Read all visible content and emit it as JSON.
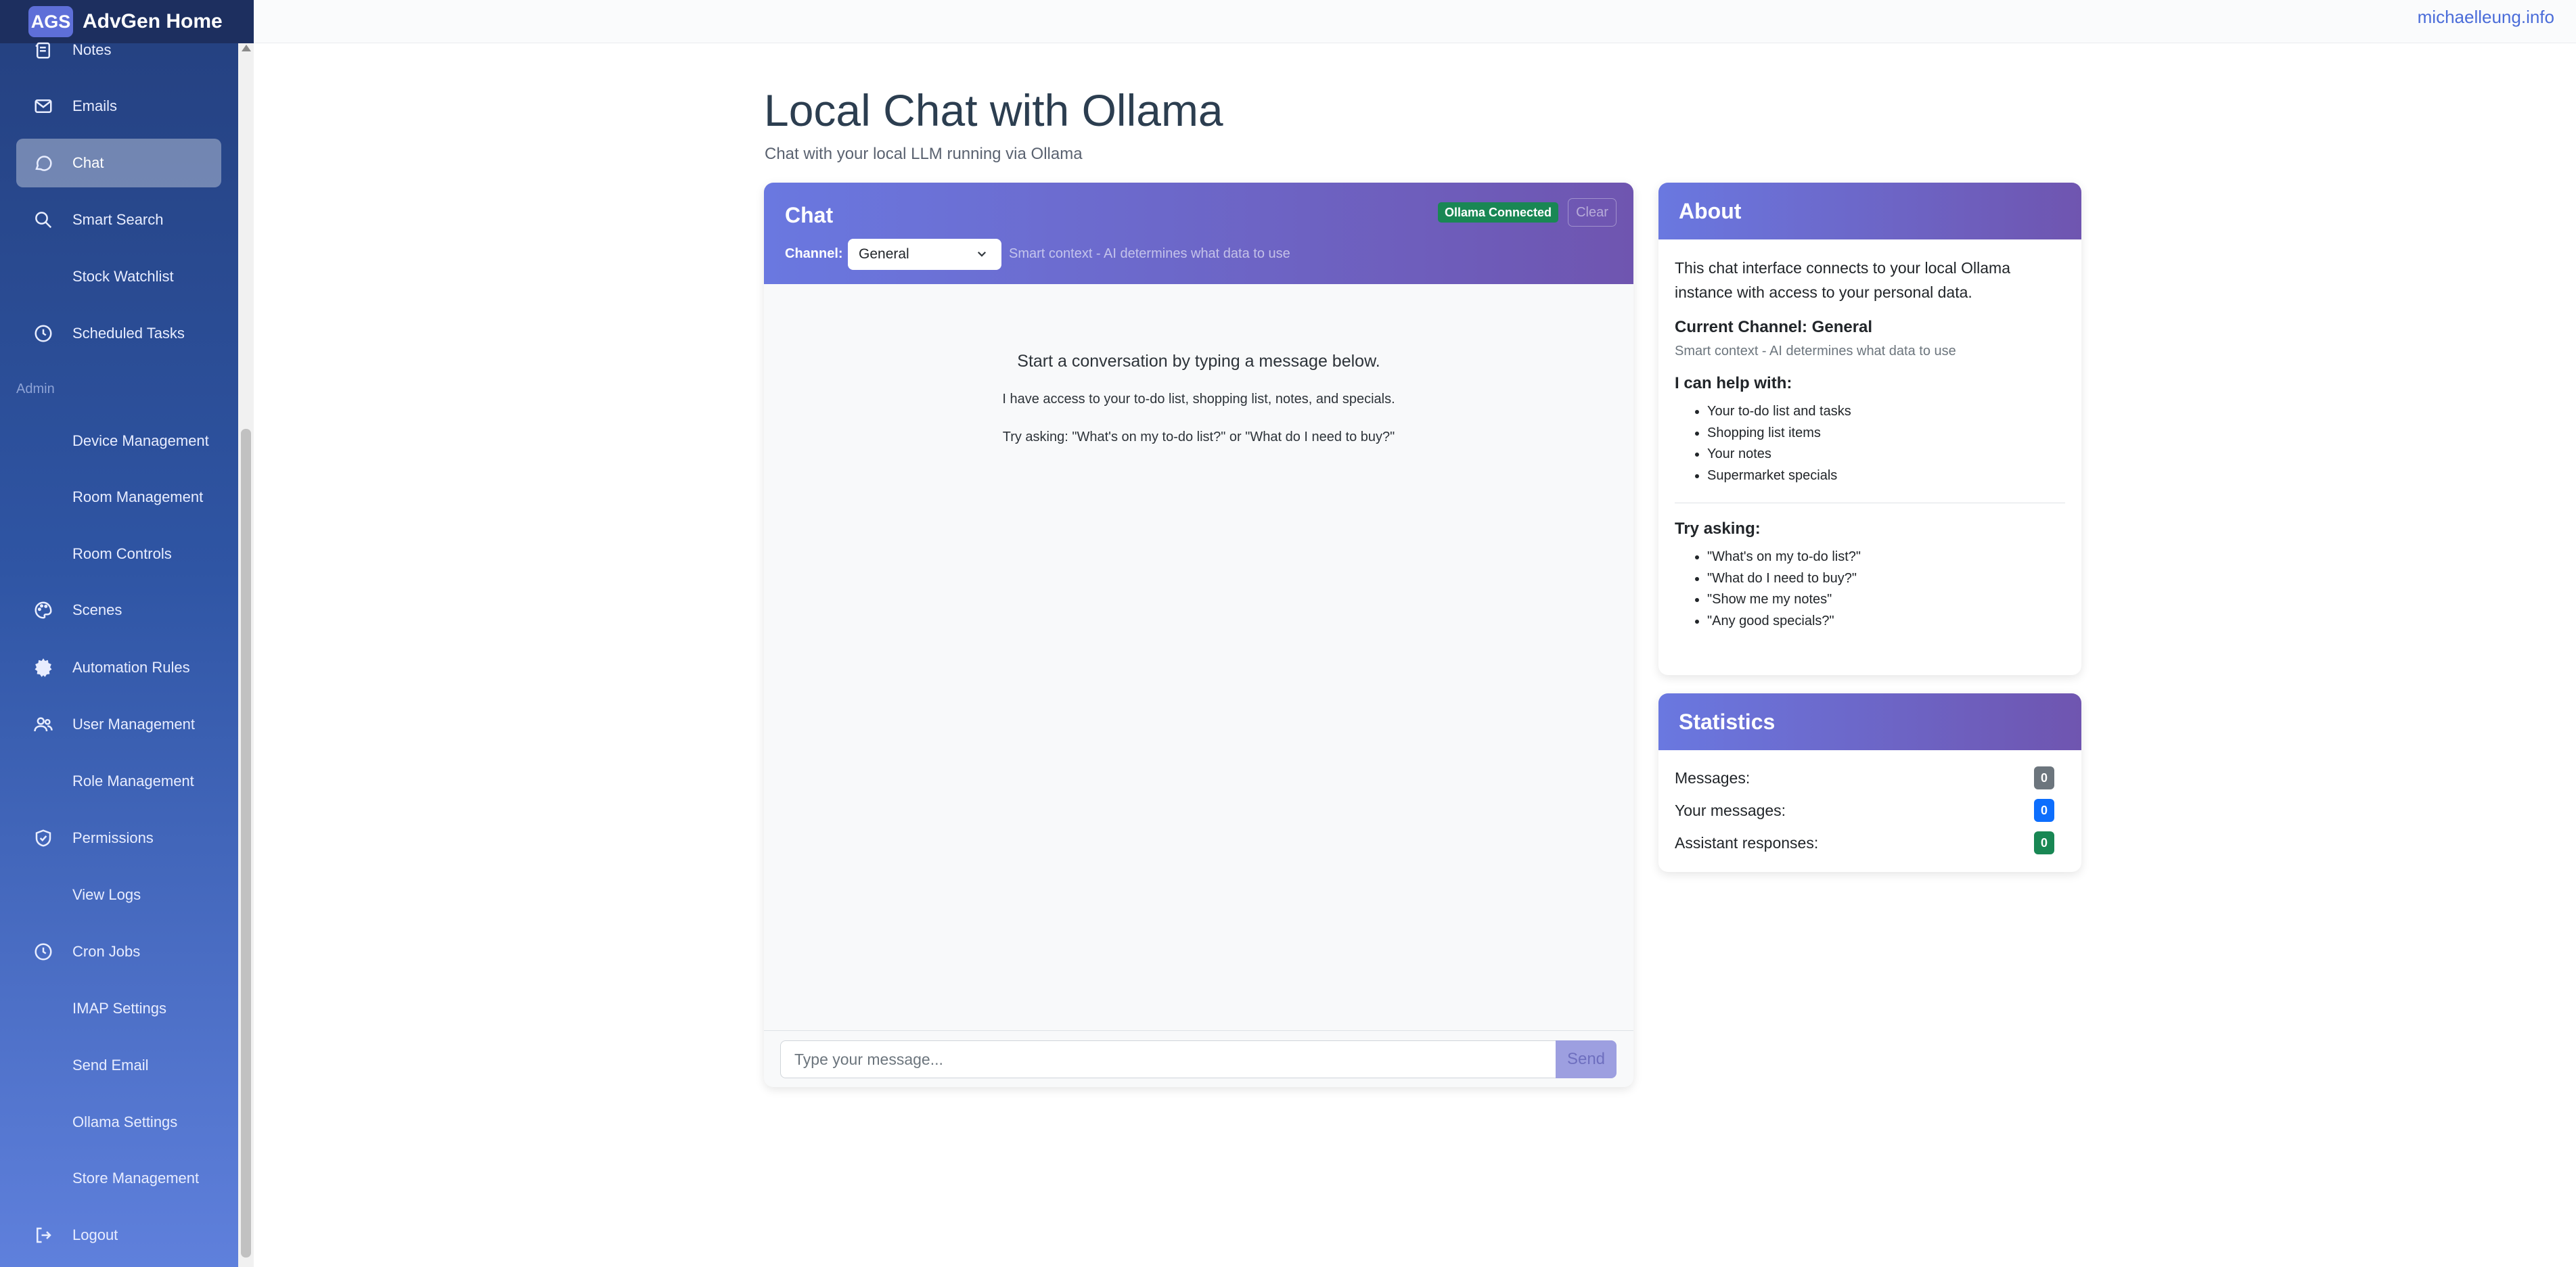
{
  "brand": {
    "badge": "AGS",
    "title": "AdvGen Home"
  },
  "topbar": {
    "site_link": "michaelleung.info"
  },
  "sidebar": {
    "items": [
      {
        "label": "Notes",
        "icon": "notes-icon",
        "active": false
      },
      {
        "label": "Emails",
        "icon": "envelope-icon",
        "active": false
      },
      {
        "label": "Chat",
        "icon": "chat-icon",
        "active": true
      },
      {
        "label": "Smart Search",
        "icon": "search-icon",
        "active": false
      },
      {
        "label": "Stock Watchlist",
        "icon": "",
        "active": false
      },
      {
        "label": "Scheduled Tasks",
        "icon": "clock-icon",
        "active": false
      },
      {
        "label": "Device Management",
        "icon": "",
        "active": false
      },
      {
        "label": "Room Management",
        "icon": "",
        "active": false
      },
      {
        "label": "Room Controls",
        "icon": "",
        "active": false
      },
      {
        "label": "Scenes",
        "icon": "palette-icon",
        "active": false
      },
      {
        "label": "Automation Rules",
        "icon": "gear-icon",
        "active": false
      },
      {
        "label": "User Management",
        "icon": "users-icon",
        "active": false
      },
      {
        "label": "Role Management",
        "icon": "",
        "active": false
      },
      {
        "label": "Permissions",
        "icon": "shield-icon",
        "active": false
      },
      {
        "label": "View Logs",
        "icon": "",
        "active": false
      },
      {
        "label": "Cron Jobs",
        "icon": "clock-icon",
        "active": false
      },
      {
        "label": "IMAP Settings",
        "icon": "",
        "active": false
      },
      {
        "label": "Send Email",
        "icon": "",
        "active": false
      },
      {
        "label": "Ollama Settings",
        "icon": "",
        "active": false
      },
      {
        "label": "Store Management",
        "icon": "",
        "active": false
      },
      {
        "label": "Logout",
        "icon": "logout-icon",
        "active": false
      }
    ],
    "section_admin": "Admin"
  },
  "page": {
    "title": "Local Chat with Ollama",
    "subtitle": "Chat with your local LLM running via Ollama"
  },
  "chat": {
    "title": "Chat",
    "status": "Ollama Connected",
    "clear_label": "Clear",
    "channel_label": "Channel:",
    "channel_value": "General",
    "context_note": "Smart context - AI determines what data to use",
    "empty_line1": "Start a conversation by typing a message below.",
    "empty_line2": "I have access to your to-do list, shopping list, notes, and specials.",
    "empty_line3": "Try asking: \"What's on my to-do list?\" or \"What do I need to buy?\"",
    "input_placeholder": "Type your message...",
    "send_label": "Send"
  },
  "about": {
    "title": "About",
    "description": "This chat interface connects to your local Ollama instance with access to your personal data.",
    "current_channel": "Current Channel: General",
    "channel_note": "Smart context - AI determines what data to use",
    "help_heading": "I can help with:",
    "help_items": [
      "Your to-do list and tasks",
      "Shopping list items",
      "Your notes",
      "Supermarket specials"
    ],
    "try_heading": "Try asking:",
    "try_items": [
      "\"What's on my to-do list?\"",
      "\"What do I need to buy?\"",
      "\"Show me my notes\"",
      "\"Any good specials?\""
    ]
  },
  "statistics": {
    "title": "Statistics",
    "rows": [
      {
        "label": "Messages:",
        "value": "0",
        "color": "#6c757d"
      },
      {
        "label": "Your messages:",
        "value": "0",
        "color": "#0d6efd"
      },
      {
        "label": "Assistant responses:",
        "value": "0",
        "color": "#198754"
      }
    ]
  },
  "colors": {
    "sidebar_top": "#24407f",
    "sidebar_bottom": "#5f80dc",
    "header_start": "#6a78e0",
    "header_end": "#6f55b0",
    "status_green": "#198754",
    "link_blue": "#4a6cd9"
  }
}
